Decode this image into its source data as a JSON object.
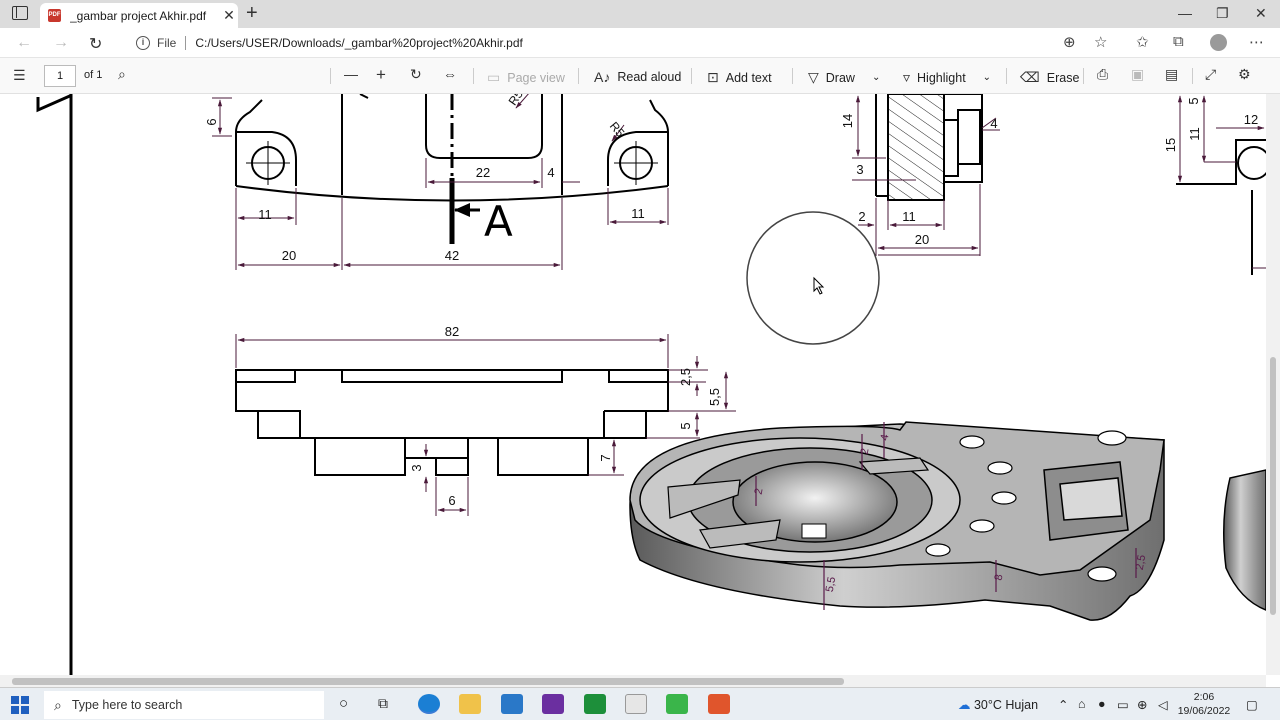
{
  "browser": {
    "tab_title": "_gambar project Akhir.pdf",
    "file_label": "File",
    "url": "C:/Users/USER/Downloads/_gambar%20project%20Akhir.pdf"
  },
  "pdf_toolbar": {
    "page_number": "1",
    "page_count": "of 1",
    "page_view": "Page view",
    "read_aloud": "Read aloud",
    "add_text": "Add text",
    "draw": "Draw",
    "highlight": "Highlight",
    "erase": "Erase"
  },
  "drawing": {
    "dims": {
      "d6": "6",
      "r5a": "R5",
      "r5b": "R5",
      "d22": "22",
      "d4a": "4",
      "d11a": "11",
      "d11b": "11",
      "d20a": "20",
      "d42": "42",
      "sectionA": "A",
      "d14": "14",
      "d3a": "3",
      "d4b": "4",
      "d2a": "2",
      "d11c": "11",
      "d20b": "20",
      "d5a": "5",
      "d15": "15",
      "d11d": "11",
      "d12": "12",
      "d82": "82",
      "d25": "2,5",
      "d55": "5,5",
      "d5b": "5",
      "d7": "7",
      "d3b": "3",
      "d6b": "6",
      "iso2a": "2",
      "iso4": "4",
      "iso2b": "2",
      "iso55": "5,5",
      "iso8": "8",
      "iso25": "2,5"
    }
  },
  "taskbar": {
    "search_placeholder": "Type here to search",
    "weather": "30°C  Hujan",
    "time": "2:06",
    "date": "19/06/2022"
  }
}
